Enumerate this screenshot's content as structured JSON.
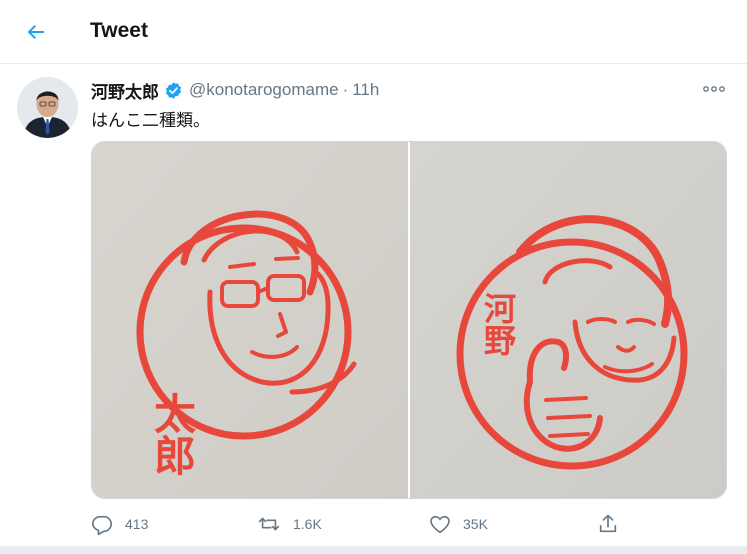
{
  "header": {
    "title": "Tweet",
    "back_icon": "arrow-left-icon"
  },
  "tweet": {
    "display_name": "河野太郎",
    "verified": true,
    "handle": "@konotarogomame",
    "separator": "·",
    "time": "11h",
    "text": "はんこ二種類。",
    "more_icon": "more-horizontal-icon",
    "media": [
      {
        "kind": "photo",
        "description_icon": "hanko-stamp-taro"
      },
      {
        "kind": "photo",
        "description_icon": "hanko-stamp-thumbs-up"
      }
    ],
    "stamp_text": {
      "left": "太郎",
      "right": "河野"
    },
    "actions": {
      "reply_count": "413",
      "retweet_count": "1.6K",
      "like_count": "35K"
    }
  },
  "colors": {
    "accent": "#1da1f2",
    "text": "#14171a",
    "muted": "#657786",
    "border": "#e6ecf0",
    "stamp_red": "#e8483c"
  }
}
